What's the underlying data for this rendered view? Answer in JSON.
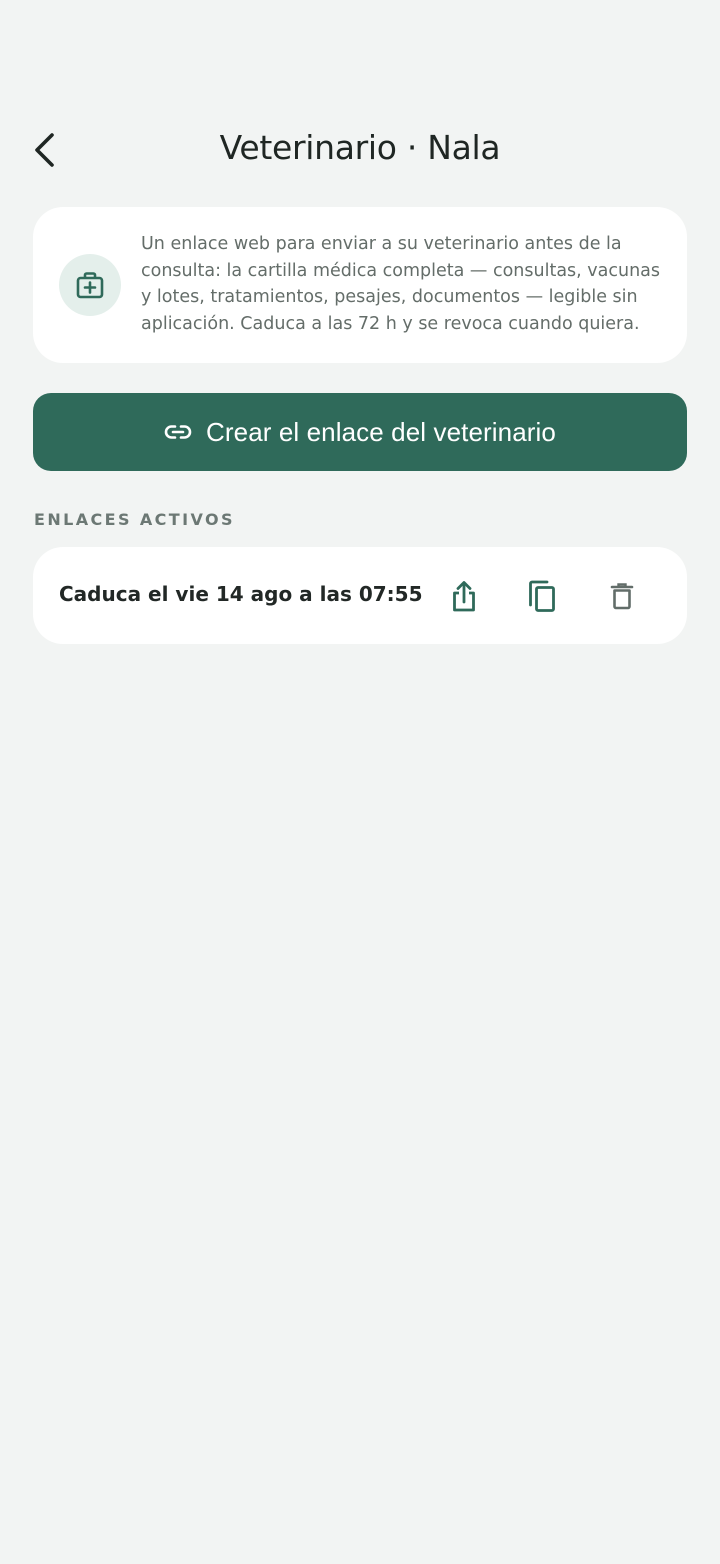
{
  "header": {
    "title": "Veterinario · Nala",
    "back_icon": "chevron-left-icon"
  },
  "info_card": {
    "icon": "medical-kit-icon",
    "text": "Un enlace web para enviar a su veterinario antes de la consulta: la cartilla médica completa — consultas, vacunas y lotes, tratamientos, pesajes, documentos — legible sin aplicación. Caduca a las 72 h y se revoca cuando quiera."
  },
  "create_button": {
    "icon": "link-icon",
    "label": "Crear el enlace del veterinario"
  },
  "active_links": {
    "section_label": "ENLACES ACTIVOS",
    "items": [
      {
        "expiry": "Caduca el vie 14 ago a las 07:55",
        "actions": [
          "share-icon",
          "copy-icon",
          "delete-icon"
        ]
      }
    ]
  },
  "colors": {
    "background": "#f2f4f3",
    "card": "#ffffff",
    "accent": "#2f6a5a",
    "icon_bg": "#e4efeb",
    "muted_text": "#646d69",
    "section_label": "#6c7874"
  }
}
